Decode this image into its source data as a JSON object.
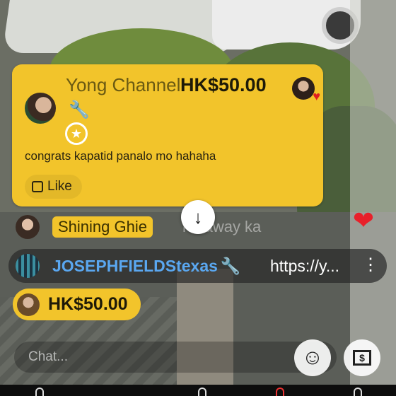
{
  "superchat": {
    "channel_name": "Yong Channel",
    "amount": "HK$50.00",
    "message": "congrats kapatid panalo mo hahaha",
    "like_label": "Like"
  },
  "chat": {
    "row2": {
      "name": "Shining Ghie",
      "text": "ho away ka"
    },
    "row3": {
      "name": "JOSEPHFIELDStexas",
      "text": "https://y..."
    },
    "pinned_amount": "HK$50.00"
  },
  "input": {
    "placeholder": "Chat..."
  },
  "colors": {
    "superchat_yellow": "#f2c42b",
    "link_blue": "#5aa7f0",
    "heart_red": "#e8202a"
  }
}
